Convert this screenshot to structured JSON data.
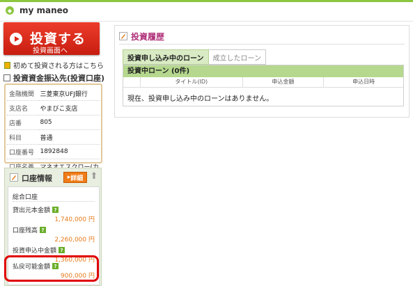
{
  "header": {
    "brand": "my maneo"
  },
  "invest_button": {
    "label": "投資する",
    "sublabel": "投資画面へ"
  },
  "first_link": "初めて投資される方はこちら",
  "deposit": {
    "title": "投資資金振込先(投資口座)",
    "rows": [
      {
        "key": "金融機関",
        "value": "三菱東京UFJ銀行"
      },
      {
        "key": "支店名",
        "value": "やまびこ支店"
      },
      {
        "key": "店番",
        "value": "805"
      },
      {
        "key": "科目",
        "value": "普通"
      },
      {
        "key": "口座番号",
        "value": "1892848"
      },
      {
        "key": "口座名義",
        "value": "マネオエスクロー(カ"
      }
    ]
  },
  "account": {
    "title": "口座情報",
    "detail_label": "詳細",
    "summary_title": "総合口座",
    "items": [
      {
        "label": "貸出元本金額",
        "amount": "1,740,000 円"
      },
      {
        "label": "口座残高",
        "amount": "2,260,000 円"
      },
      {
        "label": "投資申込中金額",
        "amount": "1,360,000 円"
      },
      {
        "label": "払戻可能金額",
        "amount": "900,000 円"
      }
    ]
  },
  "history": {
    "title": "投資履歴",
    "tabs": [
      {
        "label": "投資申し込み中のローン",
        "active": true
      },
      {
        "label": "成立したローン",
        "active": false
      }
    ],
    "loan_header": "投資中ローン (0件)",
    "columns": [
      "",
      "タイトル(ID)",
      "申込金額",
      "申込日時"
    ],
    "empty_message": "現在、投資申し込み中のローンはありません。"
  },
  "colors": {
    "accent_green": "#8cc63f",
    "invest_red": "#d8281c",
    "history_title": "#b0327a",
    "amount_orange": "#e57a1a"
  }
}
